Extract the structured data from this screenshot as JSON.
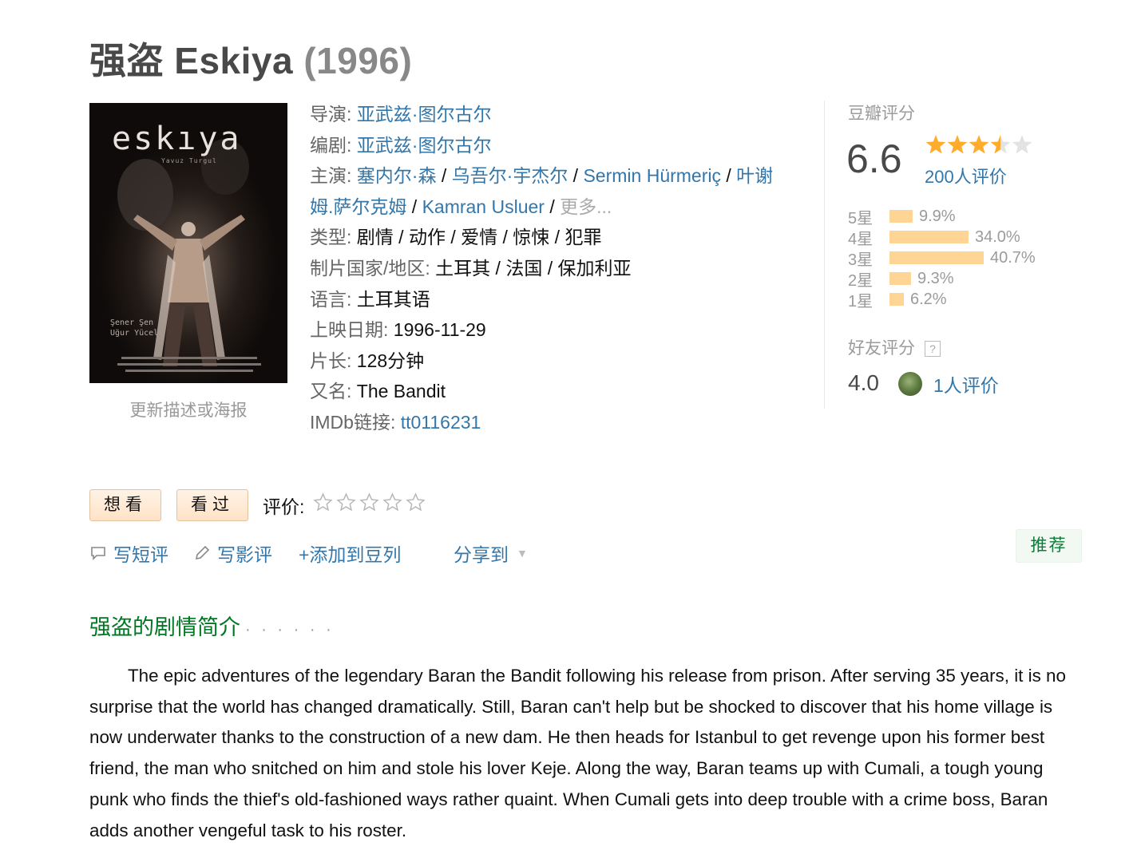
{
  "movie": {
    "title_cn": "强盗",
    "title_en": "Eskiya",
    "year": "(1996)"
  },
  "poster": {
    "title_art": "eskıya",
    "director_small": "Yavuz Turgul",
    "cast_1": "Şener Şen",
    "cast_2": "Uğur Yücel"
  },
  "update_link": "更新描述或海报",
  "info": {
    "director_label": "导演",
    "director": "亚武兹·图尔古尔",
    "writer_label": "编剧",
    "writer": "亚武兹·图尔古尔",
    "cast_label": "主演",
    "cast": [
      "塞内尔·森",
      "乌吾尔·宇杰尔",
      "Sermin Hürmeriç",
      "叶谢",
      "姆.萨尔克姆",
      "Kamran Usluer"
    ],
    "cast_more": "更多...",
    "genre_label": "类型",
    "genres": "剧情 / 动作 / 爱情 / 惊悚 / 犯罪",
    "country_label": "制片国家/地区",
    "countries": "土耳其 / 法国 / 保加利亚",
    "language_label": "语言",
    "language": "土耳其语",
    "release_label": "上映日期",
    "release": "1996-11-29",
    "runtime_label": "片长",
    "runtime": "128分钟",
    "aka_label": "又名",
    "aka": "The Bandit",
    "imdb_label": "IMDb链接",
    "imdb": "tt0116231"
  },
  "rating": {
    "label": "豆瓣评分",
    "score": "6.6",
    "stars": 3.5,
    "count": "200人评价",
    "distribution": [
      {
        "label": "5星",
        "percent": 9.9,
        "text": "9.9%"
      },
      {
        "label": "4星",
        "percent": 34.0,
        "text": "34.0%"
      },
      {
        "label": "3星",
        "percent": 40.7,
        "text": "40.7%"
      },
      {
        "label": "2星",
        "percent": 9.3,
        "text": "9.3%"
      },
      {
        "label": "1星",
        "percent": 6.2,
        "text": "6.2%"
      }
    ],
    "friend_label": "好友评分",
    "friend_help": "?",
    "friend_score": "4.0",
    "friend_count": "1人评价"
  },
  "actions": {
    "want": "想看",
    "seen": "看过",
    "rate_label": "评价:",
    "short_review": "写短评",
    "review": "写影评",
    "add_list": "+添加到豆列",
    "share": "分享到",
    "recommend": "推荐"
  },
  "synopsis": {
    "title": "强盗的剧情简介",
    "dots": "· · · · · ·",
    "text": "The epic adventures of the legendary Baran the Bandit following his release from prison. After serving 35 years, it is no surprise that the world has changed dramatically. Still, Baran can't help but be shocked to discover that his home village is now underwater thanks to the construction of a new dam. He then heads for Istanbul to get revenge upon his former best friend, the man who snitched on him and stole his lover Keje. Along the way, Baran teams up with Cumali, a tough young punk who finds the thief's old-fashioned ways rather quaint. When Cumali gets into deep trouble with a crime boss, Baran adds another vengeful task to his roster."
  },
  "colors": {
    "link": "#3377aa",
    "bar": "#ffd596",
    "green": "#007722",
    "star": "#ffac2d"
  }
}
